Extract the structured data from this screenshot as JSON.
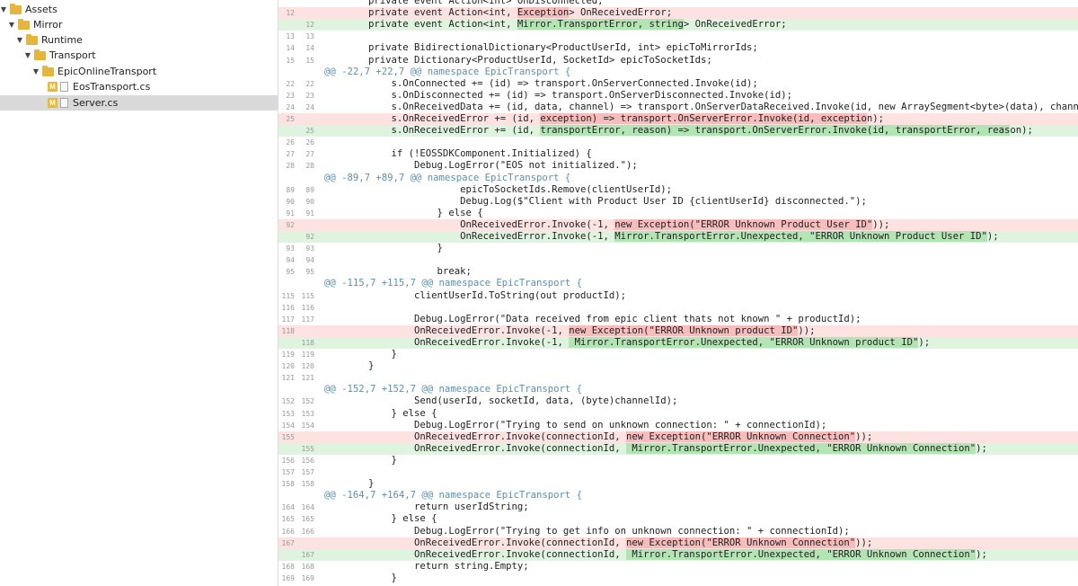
{
  "sidebar": {
    "items": [
      {
        "label": "Assets",
        "kind": "folder",
        "expanded": true,
        "depth": 0,
        "selected": false
      },
      {
        "label": "Mirror",
        "kind": "folder",
        "expanded": true,
        "depth": 1,
        "selected": false
      },
      {
        "label": "Runtime",
        "kind": "folder",
        "expanded": true,
        "depth": 2,
        "selected": false
      },
      {
        "label": "Transport",
        "kind": "folder",
        "expanded": true,
        "depth": 3,
        "selected": false
      },
      {
        "label": "EpicOnlineTransport",
        "kind": "folder",
        "expanded": true,
        "depth": 4,
        "selected": false
      },
      {
        "label": "EosTransport.cs",
        "kind": "file",
        "status": "M",
        "depth": 5,
        "selected": false
      },
      {
        "label": "Server.cs",
        "kind": "file",
        "status": "M",
        "depth": 5,
        "selected": true
      }
    ]
  },
  "diff": {
    "lines": [
      {
        "type": "ctx",
        "old": "",
        "new": "",
        "code": "        private event Action<int> OnDisconnected;"
      },
      {
        "type": "del",
        "old": "12",
        "new": "",
        "code": "        private event Action<int, ",
        "hl": "Exception",
        "post": "> OnReceivedError;"
      },
      {
        "type": "add",
        "old": "",
        "new": "12",
        "code": "        private event Action<int, ",
        "hl": "Mirror.TransportError, string",
        "post": "> OnReceivedError;"
      },
      {
        "type": "ctx",
        "old": "13",
        "new": "13",
        "code": ""
      },
      {
        "type": "ctx",
        "old": "14",
        "new": "14",
        "code": "        private BidirectionalDictionary<ProductUserId, int> epicToMirrorIds;"
      },
      {
        "type": "ctx",
        "old": "15",
        "new": "15",
        "code": "        private Dictionary<ProductUserId, SocketId> epicToSocketIds;"
      },
      {
        "type": "hunk",
        "old": "",
        "new": "",
        "code": "@@ -22,7 +22,7 @@ namespace EpicTransport {"
      },
      {
        "type": "ctx",
        "old": "22",
        "new": "22",
        "code": "            s.OnConnected += (id) => transport.OnServerConnected.Invoke(id);"
      },
      {
        "type": "ctx",
        "old": "23",
        "new": "23",
        "code": "            s.OnDisconnected += (id) => transport.OnServerDisconnected.Invoke(id);"
      },
      {
        "type": "ctx",
        "old": "24",
        "new": "24",
        "code": "            s.OnReceivedData += (id, data, channel) => transport.OnServerDataReceived.Invoke(id, new ArraySegment<byte>(data), channel);"
      },
      {
        "type": "del",
        "old": "25",
        "new": "",
        "code": "            s.OnReceivedError += (id, ",
        "hl": "exception) => transport.OnServerError.Invoke(id, exceptio",
        "post": "n);"
      },
      {
        "type": "add",
        "old": "",
        "new": "25",
        "code": "            s.OnReceivedError += (id, ",
        "hl": "transportError, reason) => transport.OnServerError.Invoke(id, transportError, reas",
        "post": "on);"
      },
      {
        "type": "ctx",
        "old": "26",
        "new": "26",
        "code": ""
      },
      {
        "type": "ctx",
        "old": "27",
        "new": "27",
        "code": "            if (!EOSSDKComponent.Initialized) {"
      },
      {
        "type": "ctx",
        "old": "28",
        "new": "28",
        "code": "                Debug.LogError(\"EOS not initialized.\");"
      },
      {
        "type": "hunk",
        "old": "",
        "new": "",
        "code": "@@ -89,7 +89,7 @@ namespace EpicTransport {"
      },
      {
        "type": "ctx",
        "old": "89",
        "new": "89",
        "code": "                        epicToSocketIds.Remove(clientUserId);"
      },
      {
        "type": "ctx",
        "old": "90",
        "new": "90",
        "code": "                        Debug.Log($\"Client with Product User ID {clientUserId} disconnected.\");"
      },
      {
        "type": "ctx",
        "old": "91",
        "new": "91",
        "code": "                    } else {"
      },
      {
        "type": "del",
        "old": "92",
        "new": "",
        "code": "                        OnReceivedError.Invoke(-1, ",
        "hl": "new Exception(\"ERROR Unknown Product User ID\"",
        "post": "));"
      },
      {
        "type": "add",
        "old": "",
        "new": "92",
        "code": "                        OnReceivedError.Invoke(-1, ",
        "hl": "Mirror.TransportError.Unexpected, \"ERROR Unknown Product User ID\"",
        "post": ");"
      },
      {
        "type": "ctx",
        "old": "93",
        "new": "93",
        "code": "                    }"
      },
      {
        "type": "ctx",
        "old": "94",
        "new": "94",
        "code": ""
      },
      {
        "type": "ctx",
        "old": "95",
        "new": "95",
        "code": "                    break;"
      },
      {
        "type": "hunk",
        "old": "",
        "new": "",
        "code": "@@ -115,7 +115,7 @@ namespace EpicTransport {"
      },
      {
        "type": "ctx",
        "old": "115",
        "new": "115",
        "code": "                clientUserId.ToString(out productId);"
      },
      {
        "type": "ctx",
        "old": "116",
        "new": "116",
        "code": ""
      },
      {
        "type": "ctx",
        "old": "117",
        "new": "117",
        "code": "                Debug.LogError(\"Data received from epic client thats not known \" + productId);"
      },
      {
        "type": "del",
        "old": "118",
        "new": "",
        "code": "                OnReceivedError.Invoke(-1, ",
        "hl": "new Exception(\"ERROR Unknown product ID\"",
        "post": "));"
      },
      {
        "type": "add",
        "old": "",
        "new": "118",
        "code": "                OnReceivedError.Invoke(-1, ",
        "hl": " Mirror.TransportError.Unexpected, \"ERROR Unknown product ID\"",
        "post": ");"
      },
      {
        "type": "ctx",
        "old": "119",
        "new": "119",
        "code": "            }"
      },
      {
        "type": "ctx",
        "old": "120",
        "new": "120",
        "code": "        }"
      },
      {
        "type": "ctx",
        "old": "121",
        "new": "121",
        "code": ""
      },
      {
        "type": "hunk",
        "old": "",
        "new": "",
        "code": "@@ -152,7 +152,7 @@ namespace EpicTransport {"
      },
      {
        "type": "ctx",
        "old": "152",
        "new": "152",
        "code": "                Send(userId, socketId, data, (byte)channelId);"
      },
      {
        "type": "ctx",
        "old": "153",
        "new": "153",
        "code": "            } else {"
      },
      {
        "type": "ctx",
        "old": "154",
        "new": "154",
        "code": "                Debug.LogError(\"Trying to send on unknown connection: \" + connectionId);"
      },
      {
        "type": "del",
        "old": "155",
        "new": "",
        "code": "                OnReceivedError.Invoke(connectionId, ",
        "hl": "new Exception(\"ERROR Unknown Connection\"",
        "post": "));"
      },
      {
        "type": "add",
        "old": "",
        "new": "155",
        "code": "                OnReceivedError.Invoke(connectionId, ",
        "hl": " Mirror.TransportError.Unexpected, \"ERROR Unknown Connection\"",
        "post": ");"
      },
      {
        "type": "ctx",
        "old": "156",
        "new": "156",
        "code": "            }"
      },
      {
        "type": "ctx",
        "old": "157",
        "new": "157",
        "code": ""
      },
      {
        "type": "ctx",
        "old": "158",
        "new": "158",
        "code": "        }"
      },
      {
        "type": "hunk",
        "old": "",
        "new": "",
        "code": "@@ -164,7 +164,7 @@ namespace EpicTransport {"
      },
      {
        "type": "ctx",
        "old": "164",
        "new": "164",
        "code": "                return userIdString;"
      },
      {
        "type": "ctx",
        "old": "165",
        "new": "165",
        "code": "            } else {"
      },
      {
        "type": "ctx",
        "old": "166",
        "new": "166",
        "code": "                Debug.LogError(\"Trying to get info on unknown connection: \" + connectionId);"
      },
      {
        "type": "del",
        "old": "167",
        "new": "",
        "code": "                OnReceivedError.Invoke(connectionId, ",
        "hl": "new Exception(\"ERROR Unknown Connection\"",
        "post": "));"
      },
      {
        "type": "add",
        "old": "",
        "new": "167",
        "code": "                OnReceivedError.Invoke(connectionId, ",
        "hl": " Mirror.TransportError.Unexpected, \"ERROR Unknown Connection\"",
        "post": ");"
      },
      {
        "type": "ctx",
        "old": "168",
        "new": "168",
        "code": "                return string.Empty;"
      },
      {
        "type": "ctx",
        "old": "169",
        "new": "169",
        "code": "            }"
      }
    ]
  }
}
